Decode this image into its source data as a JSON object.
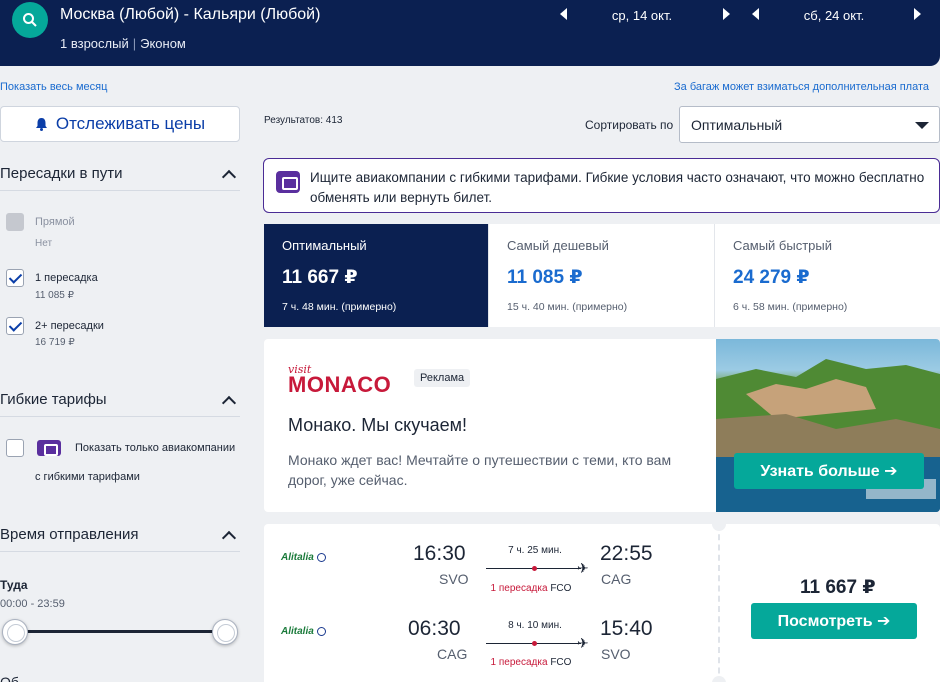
{
  "header": {
    "route": "Москва (Любой) - Кальяри (Любой)",
    "passengers": "1 взрослый",
    "cabin": "Эконом",
    "depart_date": "ср, 14 окт.",
    "return_date": "сб, 24 окт."
  },
  "links": {
    "show_month": "Показать весь месяц",
    "baggage_note": "За багаж может взиматься дополнительная плата"
  },
  "sidebar": {
    "track_prices": "Отслеживать цены",
    "stops": {
      "title": "Пересадки в пути",
      "options": [
        {
          "label": "Прямой",
          "sub": "Нет",
          "checked": false,
          "disabled": true
        },
        {
          "label": "1 пересадка",
          "sub": "11 085 ₽",
          "checked": true,
          "disabled": false
        },
        {
          "label": "2+ пересадки",
          "sub": "16 719 ₽",
          "checked": true,
          "disabled": false
        }
      ]
    },
    "flex": {
      "title": "Гибкие тарифы",
      "option_line1": "Показать только авиакомпании",
      "option_line2": "с гибкими тарифами"
    },
    "departure": {
      "title": "Время отправления",
      "label": "Туда",
      "range": "00:00 - 23:59",
      "next_title_partial": "Об"
    }
  },
  "results": {
    "count_label": "Результатов: 413",
    "sort_label": "Сортировать по",
    "sort_value": "Оптимальный",
    "flex_banner": "Ищите авиакомпании с гибкими тарифами. Гибкие условия часто означают, что можно бесплатно обменять или вернуть билет.",
    "tabs": [
      {
        "label": "Оптимальный",
        "price": "11 667 ₽",
        "duration": "7 ч. 48 мин. (примерно)"
      },
      {
        "label": "Самый дешевый",
        "price": "11 085 ₽",
        "duration": "15 ч. 40 мин. (примерно)"
      },
      {
        "label": "Самый быстрый",
        "price": "24 279 ₽",
        "duration": "6 ч. 58 мин. (примерно)"
      }
    ]
  },
  "ad": {
    "logo_visit": "visit",
    "logo_name": "MONACO",
    "tag": "Реклама",
    "headline": "Монако. Мы скучаем!",
    "body": "Монако ждет вас! Мечтайте о путешествии с теми, кто вам дорог, уже сейчас.",
    "cta": "Узнать больше ➔"
  },
  "flight": {
    "price": "11 667 ₽",
    "cta": "Посмотреть ➔",
    "legs": [
      {
        "airline": "Alitalia",
        "dep_time": "16:30",
        "dep_code": "SVO",
        "duration": "7 ч. 25 мин.",
        "stops": "1 пересадка",
        "via": "FCO",
        "arr_time": "22:55",
        "arr_code": "CAG"
      },
      {
        "airline": "Alitalia",
        "dep_time": "06:30",
        "dep_code": "CAG",
        "duration": "8 ч. 10 мин.",
        "stops": "1 пересадка",
        "via": "FCO",
        "arr_time": "15:40",
        "arr_code": "SVO"
      }
    ]
  },
  "colors": {
    "header_bg": "#0b2051",
    "accent_teal": "#05a89a",
    "link_blue": "#1a6bcf",
    "flex_purple": "#5a2f9e",
    "stop_red": "#c7193a"
  },
  "icons": [
    "search-icon",
    "arrow-left-icon",
    "arrow-right-icon",
    "bell-icon",
    "chevron-up-icon",
    "checkbox-icon",
    "flex-fare-icon",
    "plane-icon",
    "airline-logo-icon"
  ]
}
